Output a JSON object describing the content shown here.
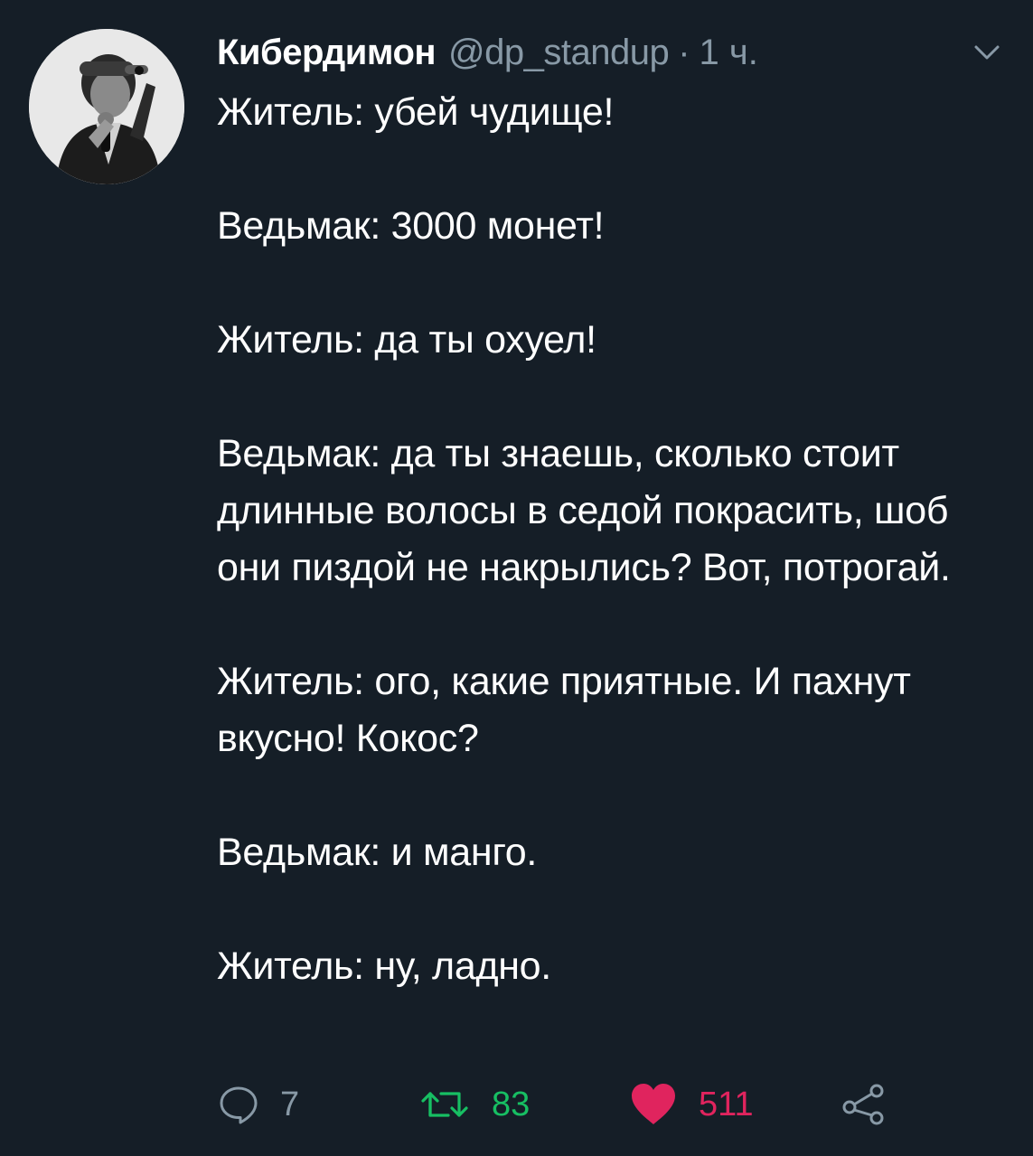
{
  "tweet": {
    "author": {
      "display_name": "Кибердимон",
      "handle": "@dp_standup",
      "separator": "·",
      "time": "1 ч."
    },
    "paragraphs": [
      "Житель: убей чудище!",
      "Ведьмак: 3000 монет!",
      "Житель: да ты охуел!",
      "Ведьмак: да ты знаешь, сколько стоит длинные волосы в седой покрасить, шоб они пиздой не накрылись? Вот, потрогай.",
      "Житель: ого, какие приятные. И пахнут вкусно! Кокос?",
      "Ведьмак: и манго.",
      "Житель: ну, ладно."
    ],
    "actions": {
      "replies": "7",
      "retweets": "83",
      "likes": "511"
    }
  },
  "icons": {
    "reply": "speech-bubble-icon",
    "retweet": "retweet-arrows-icon",
    "like": "heart-icon",
    "share": "share-nodes-icon",
    "menu": "chevron-down-icon"
  },
  "colors": {
    "background": "#151e27",
    "text": "#ffffff",
    "muted": "#8899a6",
    "retweet": "#17bf63",
    "like": "#e0245e"
  }
}
